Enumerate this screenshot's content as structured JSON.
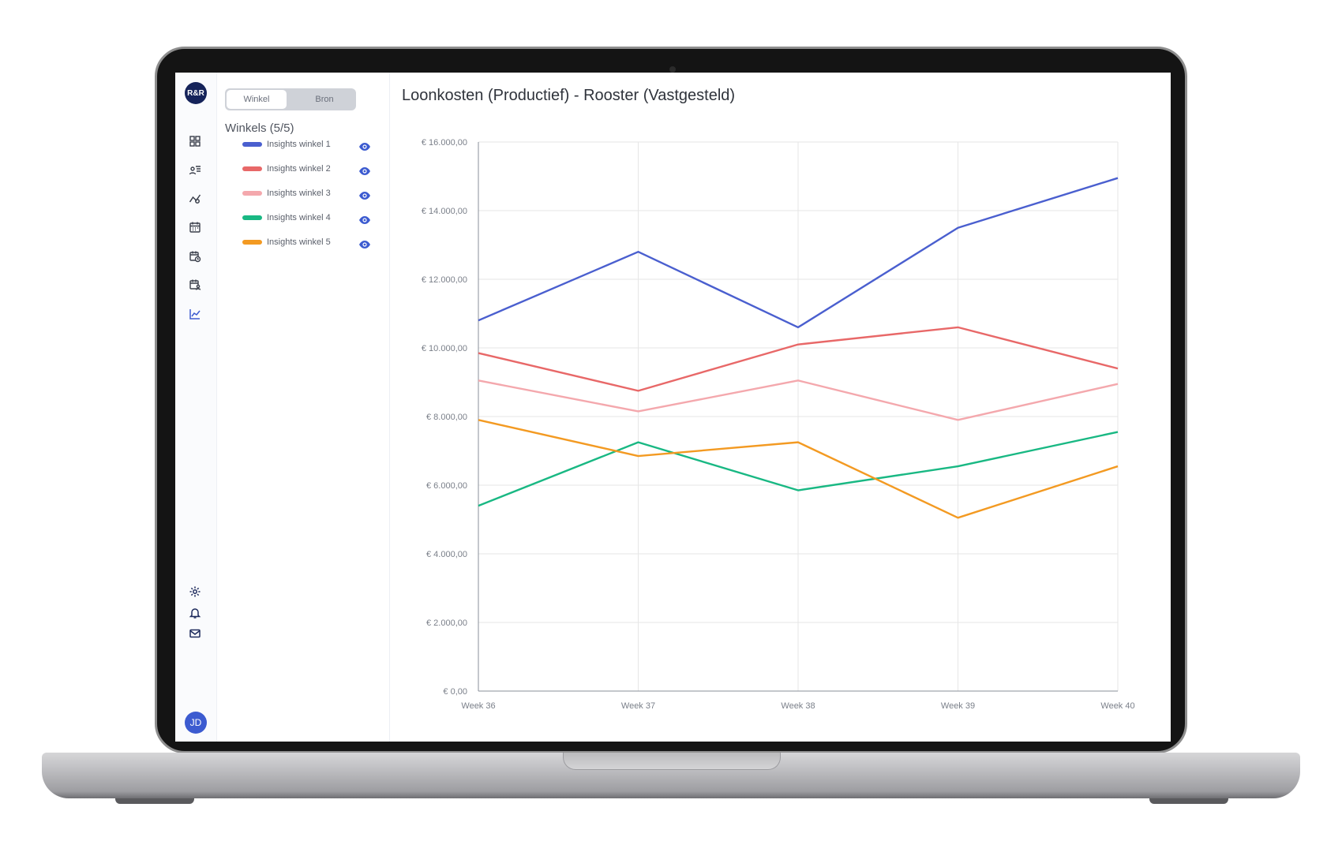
{
  "app": {
    "logo_text": "R&R",
    "avatar_initials": "JD",
    "toggle": {
      "options": [
        "Winkel",
        "Bron"
      ],
      "selected": "Winkel"
    },
    "stores_title": "Winkels (5/5)",
    "nav_icons": [
      "dashboard-icon",
      "users-list-icon",
      "analytics-icon",
      "calendar-icon",
      "calendar-clock-icon",
      "calendar-users-icon",
      "line-chart-icon"
    ],
    "bottom_icons": [
      "settings-icon",
      "bell-icon",
      "mail-icon"
    ]
  },
  "colors": {
    "accent": "#3c5bd0",
    "series": [
      "#4a5fcf",
      "#e86868",
      "#f4a8ad",
      "#19b883",
      "#f39a22"
    ]
  },
  "chart_data": {
    "type": "line",
    "title": "Loonkosten (Productief) - Rooster (Vastgesteld)",
    "x": [
      "Week 36",
      "Week 37",
      "Week 38",
      "Week 39",
      "Week 40"
    ],
    "y_ticks": [
      "€ 0,00",
      "€ 2.000,00",
      "€ 4.000,00",
      "€ 6.000,00",
      "€ 8.000,00",
      "€ 10.000,00",
      "€ 12.000,00",
      "€ 14.000,00",
      "€ 16.000,00"
    ],
    "ylim": [
      0,
      16000
    ],
    "grid": true,
    "series": [
      {
        "name": "Insights winkel 1",
        "values": [
          10800,
          12800,
          10600,
          13500,
          14950
        ]
      },
      {
        "name": "Insights winkel 2",
        "values": [
          9850,
          8750,
          10100,
          10600,
          9400
        ]
      },
      {
        "name": "Insights winkel 3",
        "values": [
          9050,
          8150,
          9050,
          7900,
          8950
        ]
      },
      {
        "name": "Insights winkel 4",
        "values": [
          5400,
          7250,
          5850,
          6550,
          7550
        ]
      },
      {
        "name": "Insights winkel 5",
        "values": [
          7900,
          6850,
          7250,
          5050,
          6550
        ]
      }
    ]
  }
}
